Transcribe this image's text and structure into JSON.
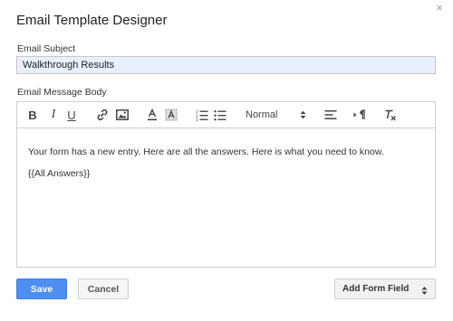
{
  "dialog": {
    "title": "Email Template Designer",
    "close_glyph": "×"
  },
  "subject": {
    "label": "Email Subject",
    "value": "Walkthrough Results"
  },
  "body": {
    "label": "Email Message Body",
    "paragraphs": [
      "Your form has a new entry. Here are all the answers.  Here is what you need to know.",
      "{{All Answers}}"
    ]
  },
  "toolbar": {
    "bold": "B",
    "italic": "I",
    "underline": "U",
    "format_value": "Normal",
    "icons": [
      "bold-icon",
      "italic-icon",
      "underline-icon",
      "link-icon",
      "image-icon",
      "text-color-icon",
      "background-color-icon",
      "ordered-list-icon",
      "bullet-list-icon",
      "align-icon",
      "text-direction-icon",
      "clear-formatting-icon"
    ]
  },
  "actions": {
    "save_label": "Save",
    "cancel_label": "Cancel",
    "add_field_label": "Add Form Field"
  },
  "colors": {
    "primary": "#4d8ef0",
    "input_bg": "#e8f0fe"
  }
}
